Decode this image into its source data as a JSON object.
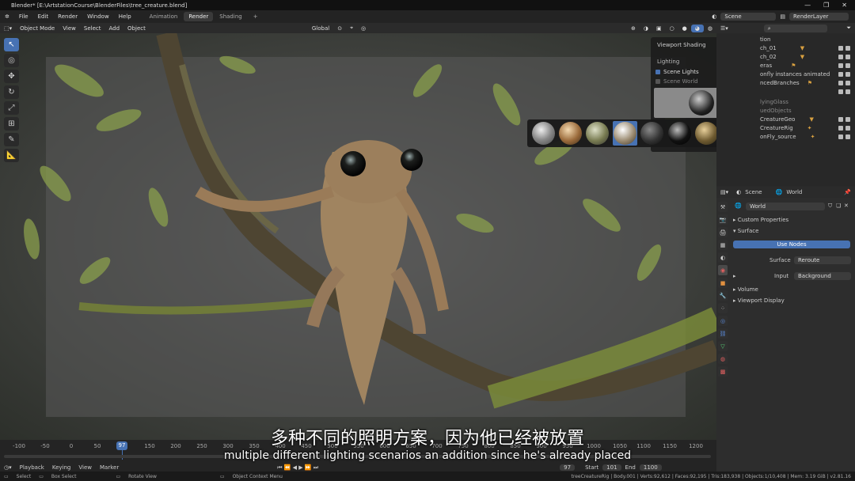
{
  "window": {
    "title": "Blender* [E:\\ArtstationCourse\\BlenderFiles\\tree_creature.blend]"
  },
  "menu": [
    "File",
    "Edit",
    "Render",
    "Window",
    "Help"
  ],
  "workspaces": [
    {
      "label": "Animation",
      "active": false
    },
    {
      "label": "Render",
      "active": true
    },
    {
      "label": "Shading",
      "active": false
    }
  ],
  "scene_name": "Scene",
  "render_layer": "RenderLayer",
  "viewport_header": {
    "mode": "Object Mode",
    "items": [
      "View",
      "Select",
      "Add",
      "Object"
    ],
    "orientation": "Global"
  },
  "shading_popover": {
    "title": "Viewport Shading",
    "section": "Lighting",
    "scene_lights": "Scene Lights",
    "scene_world": "Scene World"
  },
  "hdri_count_selected": 4,
  "outliner_rows": [
    {
      "label": "tion"
    },
    {
      "label": "ch_01"
    },
    {
      "label": "ch_02"
    },
    {
      "label": "eras"
    },
    {
      "label": "onfly instances animated"
    },
    {
      "label": "ncedBranches"
    },
    {
      "label": ""
    },
    {
      "label": "lyingGlass"
    },
    {
      "label": "uedObjects"
    },
    {
      "label": "CreatureGeo"
    },
    {
      "label": "CreatureRig"
    },
    {
      "label": "onFly_source"
    }
  ],
  "properties": {
    "scene": "Scene",
    "world": "World",
    "world_field": "World",
    "custom_properties": "Custom Properties",
    "surface": "Surface",
    "use_nodes": "Use Nodes",
    "surface_label": "Surface",
    "surface_value": "Reroute",
    "input_label": "Input",
    "input_value": "Background",
    "volume": "Volume",
    "viewport_display": "Viewport Display"
  },
  "timeline": {
    "ticks": [
      "-100",
      "-50",
      "0",
      "50",
      "150",
      "200",
      "250",
      "300",
      "350",
      "400",
      "450",
      "500",
      "550",
      "600",
      "650",
      "700",
      "750",
      "800",
      "850",
      "900",
      "950",
      "1000",
      "1050",
      "1100",
      "1150",
      "1200"
    ],
    "current_frame": "97",
    "playback": "Playback",
    "keying": "Keying",
    "view": "View",
    "marker": "Marker",
    "start_label": "Start",
    "start": "101",
    "end_label": "End",
    "end": "1100",
    "frame_field": "97"
  },
  "statusbar": {
    "select": "Select",
    "box_select": "Box Select",
    "rotate_view": "Rotate View",
    "context_menu": "Object Context Menu",
    "stats": "treeCreatureRig | Body.001 | Verts:92,612 | Faces:92,195 | Tris:183,938 | Objects:1/10,408 | Mem: 3.19 GiB | v2.81.16"
  },
  "subtitles": {
    "cn": "多种不同的照明方案，因为他已经被放置",
    "en": "multiple different lighting scenarios an addition since he's already placed"
  }
}
